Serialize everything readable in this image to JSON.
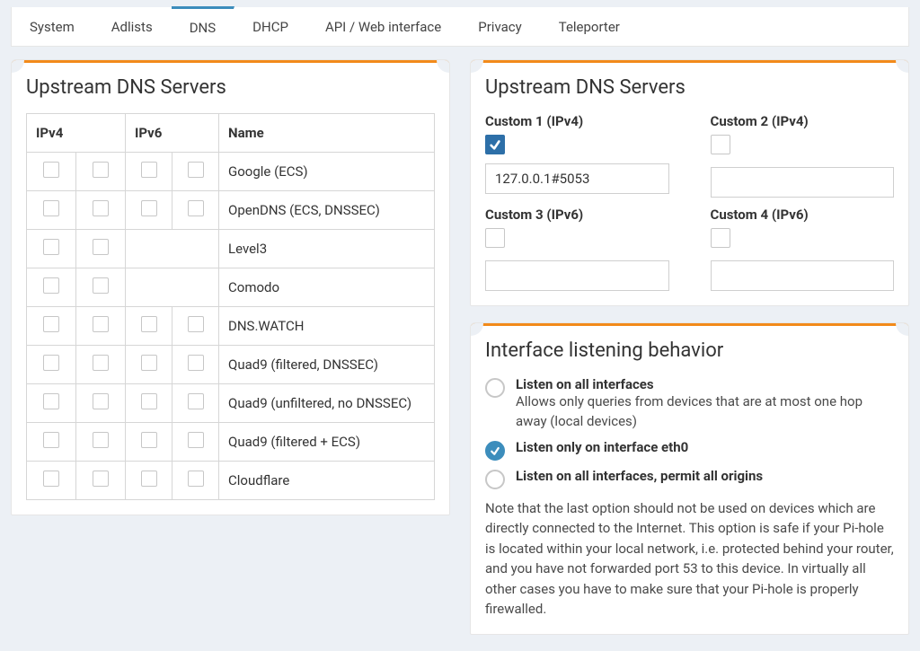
{
  "tabs": [
    "System",
    "Adlists",
    "DNS",
    "DHCP",
    "API / Web interface",
    "Privacy",
    "Teleporter"
  ],
  "active_tab_index": 2,
  "left": {
    "title": "Upstream DNS Servers",
    "headers": {
      "ipv4": "IPv4",
      "ipv6": "IPv6",
      "name": "Name"
    },
    "rows": [
      {
        "name": "Google (ECS)",
        "ipv4cols": 2,
        "ipv6cols": 2
      },
      {
        "name": "OpenDNS (ECS, DNSSEC)",
        "ipv4cols": 2,
        "ipv6cols": 2
      },
      {
        "name": "Level3",
        "ipv4cols": 2,
        "ipv6cols": 0
      },
      {
        "name": "Comodo",
        "ipv4cols": 2,
        "ipv6cols": 0
      },
      {
        "name": "DNS.WATCH",
        "ipv4cols": 2,
        "ipv6cols": 2
      },
      {
        "name": "Quad9 (filtered, DNSSEC)",
        "ipv4cols": 2,
        "ipv6cols": 2
      },
      {
        "name": "Quad9 (unfiltered, no DNSSEC)",
        "ipv4cols": 2,
        "ipv6cols": 2
      },
      {
        "name": "Quad9 (filtered + ECS)",
        "ipv4cols": 2,
        "ipv6cols": 2
      },
      {
        "name": "Cloudflare",
        "ipv4cols": 2,
        "ipv6cols": 2
      }
    ]
  },
  "custom": {
    "title": "Upstream DNS Servers",
    "items": [
      {
        "label": "Custom 1 (IPv4)",
        "checked": true,
        "value": "127.0.0.1#5053"
      },
      {
        "label": "Custom 2 (IPv4)",
        "checked": false,
        "value": ""
      },
      {
        "label": "Custom 3 (IPv6)",
        "checked": false,
        "value": ""
      },
      {
        "label": "Custom 4 (IPv6)",
        "checked": false,
        "value": ""
      }
    ]
  },
  "listen": {
    "title": "Interface listening behavior",
    "options": [
      {
        "title": "Listen on all interfaces",
        "desc": "Allows only queries from devices that are at most one hop away (local devices)",
        "checked": false
      },
      {
        "title": "Listen only on interface eth0",
        "desc": "",
        "checked": true
      },
      {
        "title": "Listen on all interfaces, permit all origins",
        "desc": "",
        "checked": false
      }
    ],
    "note": "Note that the last option should not be used on devices which are directly connected to the Internet. This option is safe if your Pi-hole is located within your local network, i.e. protected behind your router, and you have not forwarded port 53 to this device. In virtually all other cases you have to make sure that your Pi-hole is properly firewalled."
  }
}
